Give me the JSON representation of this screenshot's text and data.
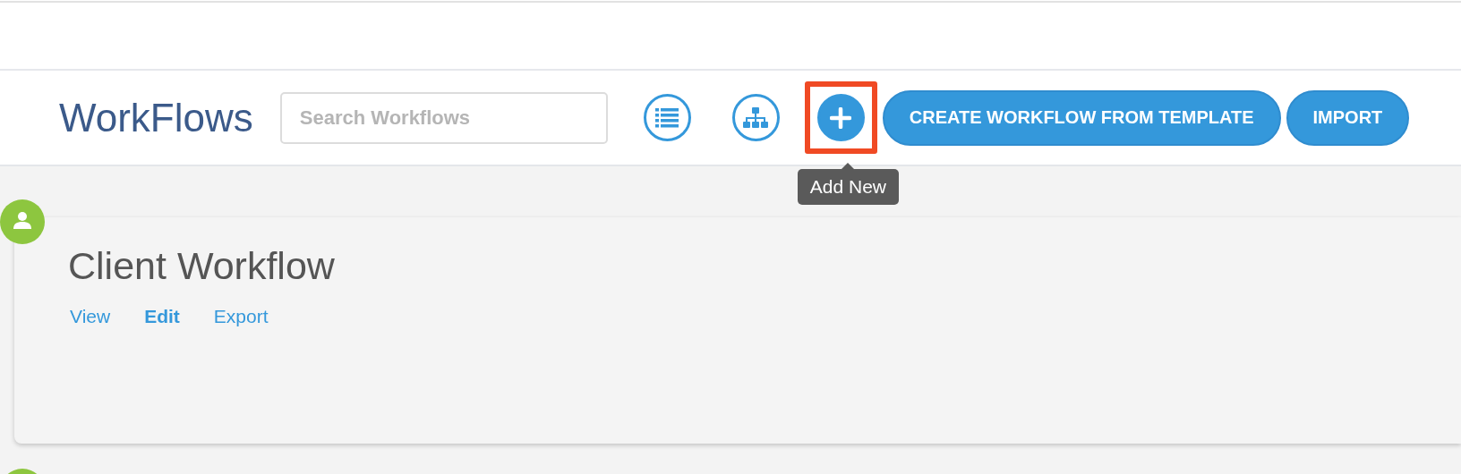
{
  "header": {
    "title": "WorkFlows",
    "search": {
      "placeholder": "Search Workflows"
    },
    "view_buttons": [
      {
        "kind": "list",
        "highlighted": false
      },
      {
        "kind": "hierarchy",
        "highlighted": false
      },
      {
        "kind": "add",
        "highlighted": true,
        "tooltip": "Add New"
      }
    ],
    "buttons": [
      "CREATE WORKFLOW FROM TEMPLATE",
      "IMPORT"
    ]
  },
  "cards": [
    {
      "title": "Client Workflow",
      "links": [
        {
          "label": "View",
          "selected": false
        },
        {
          "label": "Edit",
          "selected": true
        },
        {
          "label": "Export",
          "selected": false
        }
      ]
    }
  ]
}
